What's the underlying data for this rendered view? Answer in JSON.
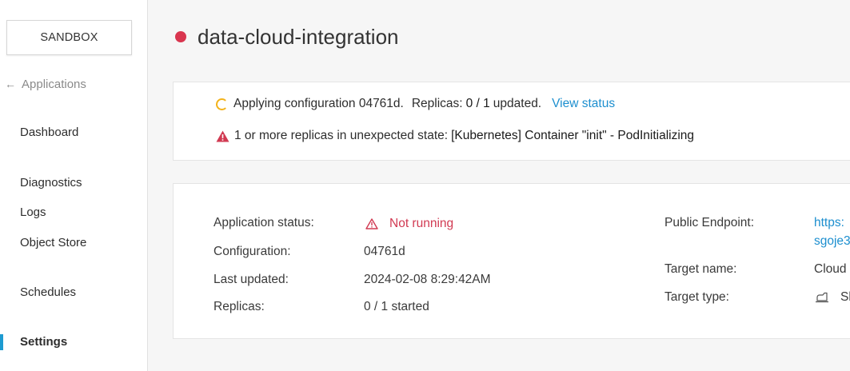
{
  "sidebar": {
    "environment_label": "SANDBOX",
    "back_label": "Applications",
    "items": [
      {
        "label": "Dashboard"
      },
      {
        "label": "Diagnostics"
      },
      {
        "label": "Logs"
      },
      {
        "label": "Object Store"
      },
      {
        "label": "Schedules"
      },
      {
        "label": "Settings",
        "active": true
      }
    ]
  },
  "header": {
    "app_name": "data-cloud-integration",
    "status_color": "#d9364f"
  },
  "status_banner": {
    "applying_text": "Applying configuration 04761d.",
    "replicas_prefix": "Replicas:",
    "replicas_value": "0 / 1",
    "replicas_suffix": "updated.",
    "view_status_label": "View status",
    "warning_prefix": "1 or more replicas in unexpected state:",
    "warning_detail": "[Kubernetes] Container \"init\" - PodInitializing"
  },
  "details": {
    "application_status_label": "Application status:",
    "application_status_value": "Not running",
    "configuration_label": "Configuration:",
    "configuration_value": "04761d",
    "last_updated_label": "Last updated:",
    "last_updated_value": "2024-02-08 8:29:42AM",
    "replicas_label": "Replicas:",
    "replicas_value": "0 / 1 started",
    "public_endpoint_label": "Public Endpoint:",
    "public_endpoint_line1": "https:",
    "public_endpoint_line2": "sgoje3",
    "target_name_label": "Target name:",
    "target_name_value": "Cloud",
    "target_type_label": "Target type:",
    "target_type_value": "Sl"
  },
  "colors": {
    "accent": "#1d9bd1",
    "link": "#1d8fcf",
    "error": "#d13a52",
    "warning": "#f3b31b"
  }
}
